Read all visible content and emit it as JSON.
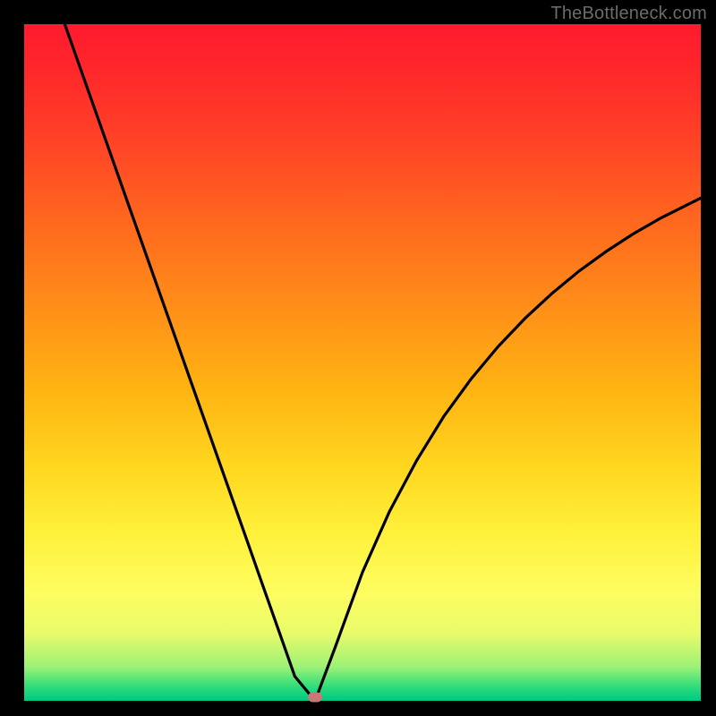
{
  "watermark": "TheBottleneck.com",
  "colors": {
    "frame": "#000000",
    "gradient_top": "#ff1a2e",
    "gradient_bottom": "#00c883",
    "curve": "#000000",
    "marker": "#c97876",
    "watermark_text": "#6b6b6b"
  },
  "chart_data": {
    "type": "line",
    "title": "",
    "xlabel": "",
    "ylabel": "",
    "xlim": [
      0,
      100
    ],
    "ylim": [
      0,
      100
    ],
    "grid": false,
    "legend": false,
    "series": [
      {
        "name": "bottleneck-curve",
        "x": [
          6,
          9,
          12,
          15,
          18,
          21,
          24,
          27,
          30,
          33,
          35,
          38,
          40,
          43,
          46,
          50,
          54,
          58,
          62,
          66,
          70,
          74,
          78,
          82,
          86,
          90,
          94,
          98,
          100
        ],
        "y": [
          100,
          91.5,
          83,
          74.5,
          66,
          57.5,
          49,
          40.5,
          32,
          23.5,
          17.8,
          9.3,
          3.6,
          0,
          8,
          19,
          28,
          35.5,
          42,
          47.5,
          52.3,
          56.5,
          60.2,
          63.5,
          66.4,
          69,
          71.3,
          73.3,
          74.3
        ]
      }
    ],
    "marker": {
      "x": 43,
      "y": 0
    },
    "notes": "V-shaped curve on a vertical heat-gradient background (red=top, green=bottom). The curve drops steeply and linearly from the top-left, reaches a sharp minimum near x≈43 at the bottom edge (green zone), then rises with decreasing slope toward the right side. A small rounded marker sits at the minimum. Axes are unlabeled; the outer region is a solid black frame."
  }
}
